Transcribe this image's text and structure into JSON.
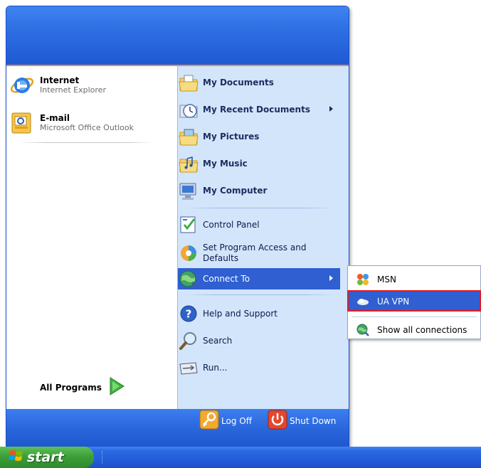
{
  "pinned": [
    {
      "title": "Internet",
      "subtitle": "Internet Explorer",
      "icon": "internet-explorer-icon"
    },
    {
      "title": "E-mail",
      "subtitle": "Microsoft Office Outlook",
      "icon": "outlook-icon"
    }
  ],
  "all_programs": {
    "label": "All Programs",
    "icon": "green-arrow-icon"
  },
  "right_items": [
    {
      "label": "My Documents",
      "icon": "folder-documents-icon",
      "bold": true
    },
    {
      "label": "My Recent Documents",
      "icon": "recent-documents-icon",
      "bold": true,
      "submenu": true
    },
    {
      "label": "My Pictures",
      "icon": "folder-pictures-icon",
      "bold": true
    },
    {
      "label": "My Music",
      "icon": "folder-music-icon",
      "bold": true
    },
    {
      "label": "My Computer",
      "icon": "computer-icon",
      "bold": true
    },
    {
      "label": "Control Panel",
      "icon": "control-panel-icon"
    },
    {
      "label": "Set Program Access and Defaults",
      "icon": "program-access-icon"
    },
    {
      "label": "Connect To",
      "icon": "network-globe-icon",
      "submenu": true,
      "highlighted": true
    },
    {
      "label": "Help and Support",
      "icon": "help-icon"
    },
    {
      "label": "Search",
      "icon": "search-icon"
    },
    {
      "label": "Run...",
      "icon": "run-icon"
    }
  ],
  "footer": {
    "log_off": "Log Off",
    "shut_down": "Shut Down"
  },
  "connect_submenu": [
    {
      "label": "MSN",
      "icon": "msn-butterfly-icon"
    },
    {
      "label": "UA VPN",
      "icon": "vpn-connection-icon",
      "highlighted": true
    },
    {
      "label": "Show all connections",
      "icon": "network-connections-icon"
    }
  ],
  "taskbar": {
    "start_label": "start"
  },
  "colors": {
    "header_blue": "#2e6fe3",
    "right_panel": "#d3e5fa",
    "highlight": "#2f5fd1",
    "start_green": "#3c9f38",
    "annotation_red": "#e31b23",
    "separator_orange": "#f28b36"
  }
}
